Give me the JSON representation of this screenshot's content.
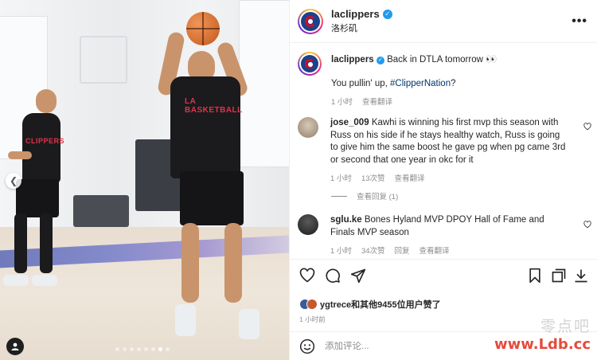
{
  "header": {
    "username": "laclippers",
    "location": "洛杉矶",
    "more_icon": "more-horizontal-icon"
  },
  "caption": {
    "username": "laclippers",
    "text": "Back in DTLA tomorrow 👀",
    "line2_prefix": "You pullin' up, ",
    "hashtag": "#ClipperNation",
    "line2_suffix": "?",
    "time": "1 小时",
    "translate": "查看翻译"
  },
  "comments": [
    {
      "username": "jose_009",
      "text": "Kawhi is winning his first mvp this season with Russ on his side if he stays healthy watch, Russ is going to give him the same boost he gave pg when pg came 3rd or second that one year in okc for it",
      "time": "1 小时",
      "likes": "13次赞",
      "translate": "查看翻译",
      "view_replies": "查看回复 (1)"
    },
    {
      "username": "sglu.ke",
      "text": "Bones Hyland MVP DPOY Hall of Fame and Finals MVP season",
      "time": "1 小时",
      "likes": "34次赞",
      "reply": "回复",
      "translate": "查看翻译"
    }
  ],
  "actions": {
    "like_icon": "heart-icon",
    "comment_icon": "comment-icon",
    "share_icon": "send-icon",
    "save_icon": "bookmark-icon",
    "fullscreen_icon": "expand-icon",
    "download_icon": "download-icon"
  },
  "likes_summary": {
    "text": "ygtrece和其他9455位用户赞了"
  },
  "post_time": "1 小时前",
  "add_comment": {
    "placeholder": "添加评论..."
  },
  "watermark": {
    "line1": "零点吧",
    "line2": "www.Ldb.cc"
  },
  "colors": {
    "link": "#00376b",
    "verified": "#1e9bf0",
    "secondary_text": "#8e8e8e"
  }
}
